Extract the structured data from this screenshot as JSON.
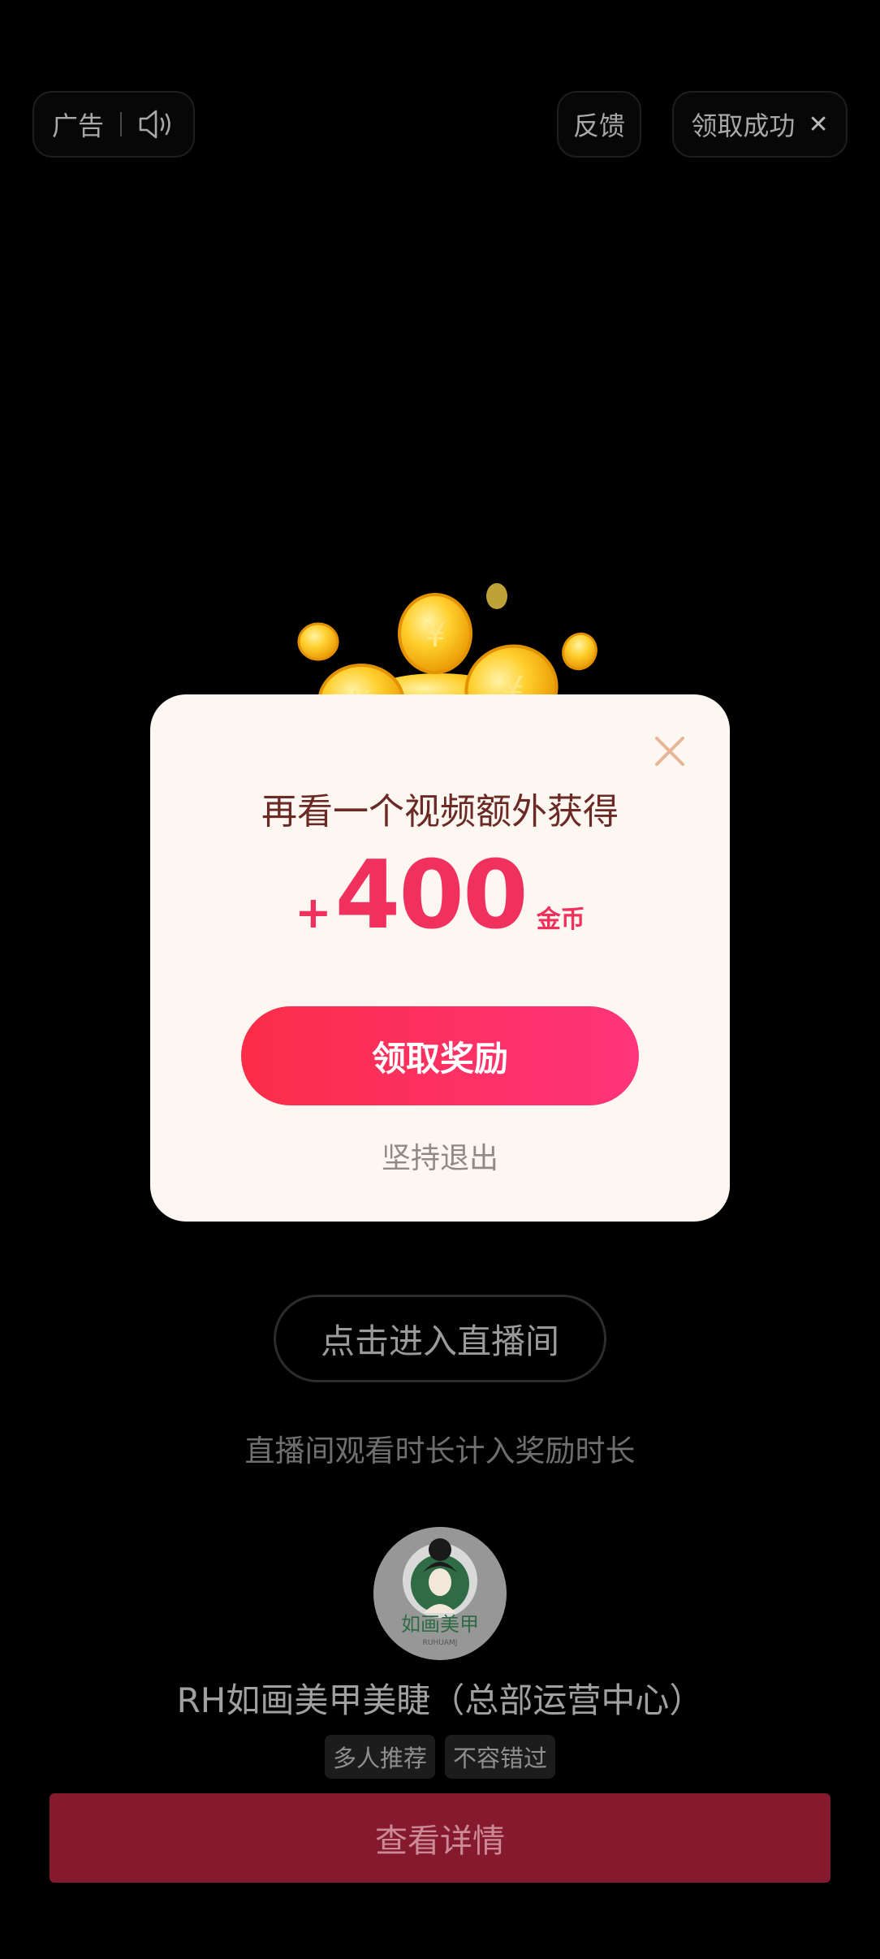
{
  "top_bar": {
    "ad_label": "广告",
    "speaker_icon": "speaker-icon",
    "feedback_label": "反馈",
    "claim_status_label": "领取成功",
    "close_icon": "close-icon"
  },
  "modal": {
    "title": "再看一个视频额外获得",
    "reward_plus": "+",
    "reward_amount": "400",
    "reward_unit": "金币",
    "claim_button_label": "领取奖励",
    "quit_label": "坚持退出",
    "close_icon": "close-icon",
    "coins_icon": "gold-coins-icon"
  },
  "live": {
    "enter_button_label": "点击进入直播间",
    "note": "直播间观看时长计入奖励时长"
  },
  "advertiser": {
    "avatar_text": "如画美甲",
    "avatar_subtext": "RUHUAMJ",
    "name": "RH如画美甲美睫（总部运营中心）",
    "tags": [
      "多人推荐",
      "不容错过"
    ],
    "detail_button_label": "查看详情"
  },
  "colors": {
    "background": "#000000",
    "modal_bg": "#fdf7f1",
    "accent": "#f0305d",
    "detail_button": "#851a2e"
  }
}
